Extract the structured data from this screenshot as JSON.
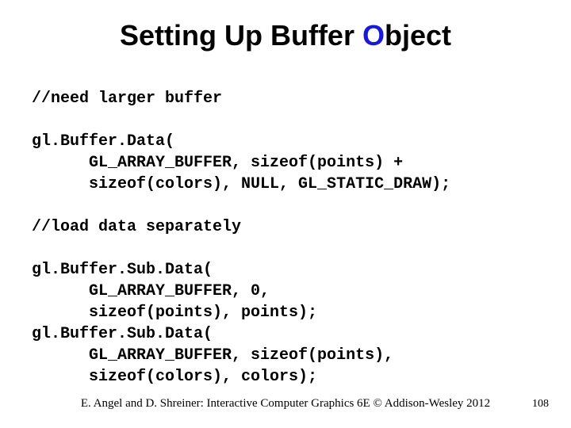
{
  "title": {
    "prefix": "Setting Up Buffer ",
    "accent_first": "O",
    "accent_rest": "bject"
  },
  "code": {
    "comment1": "//need larger buffer",
    "block1_l1": "gl.Buffer.Data(",
    "block1_l2": "      GL_ARRAY_BUFFER, sizeof(points) +",
    "block1_l3": "      sizeof(colors), NULL, GL_STATIC_DRAW);",
    "comment2": "//load data separately",
    "block2_l1": "gl.Buffer.Sub.Data(",
    "block2_l2": "      GL_ARRAY_BUFFER, 0,",
    "block2_l3": "      sizeof(points), points);",
    "block2_l4": "gl.Buffer.Sub.Data(",
    "block2_l5": "      GL_ARRAY_BUFFER, sizeof(points),",
    "block2_l6": "      sizeof(colors), colors);"
  },
  "footer": {
    "credit": "E. Angel and D. Shreiner: Interactive Computer Graphics 6E © Addison-Wesley 2012",
    "page": "108"
  }
}
